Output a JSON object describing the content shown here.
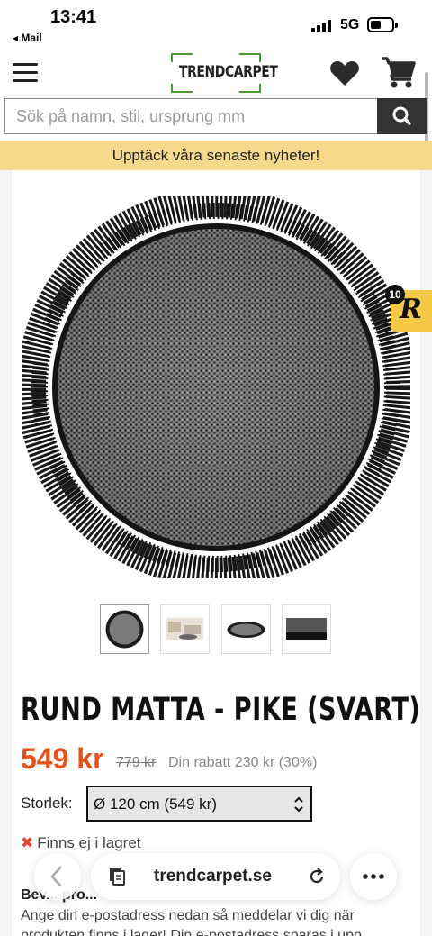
{
  "status_bar": {
    "time": "13:41",
    "back_app": "◂ Mail",
    "network": "5G"
  },
  "header": {
    "logo_text": "TRENDCARPET",
    "brand_color": "#4a9a2c"
  },
  "search": {
    "placeholder": "Sök på namn, stil, ursprung mm"
  },
  "promo": {
    "text": "Upptäck våra senaste nyheter!",
    "bg_color": "#f6d98a"
  },
  "badge": {
    "count": "10",
    "letter": "R"
  },
  "gallery": {
    "thumbnails": [
      "round-rug-top-view",
      "room-scene",
      "rug-angle-view",
      "rug-fringe-detail"
    ],
    "selected_index": 0
  },
  "product": {
    "title": "RUND MATTA - PIKE (SVART)",
    "price": "549 kr",
    "old_price": "779 kr",
    "discount": "Din rabatt 230 kr (30%)",
    "price_color": "#e8501a",
    "size_label": "Storlek:",
    "size_value": "Ø 120 cm (549 kr)",
    "stock_icon": "✖",
    "stock_text": "Finns ej i lagret",
    "notify_heading": "Bev... pro...",
    "notify_text": "Ange din e-postadress nedan så meddelar vi dig när produkten finns i lager! Din e-postadress sparas i upp"
  },
  "browser": {
    "url": "trendcarpet.se"
  }
}
